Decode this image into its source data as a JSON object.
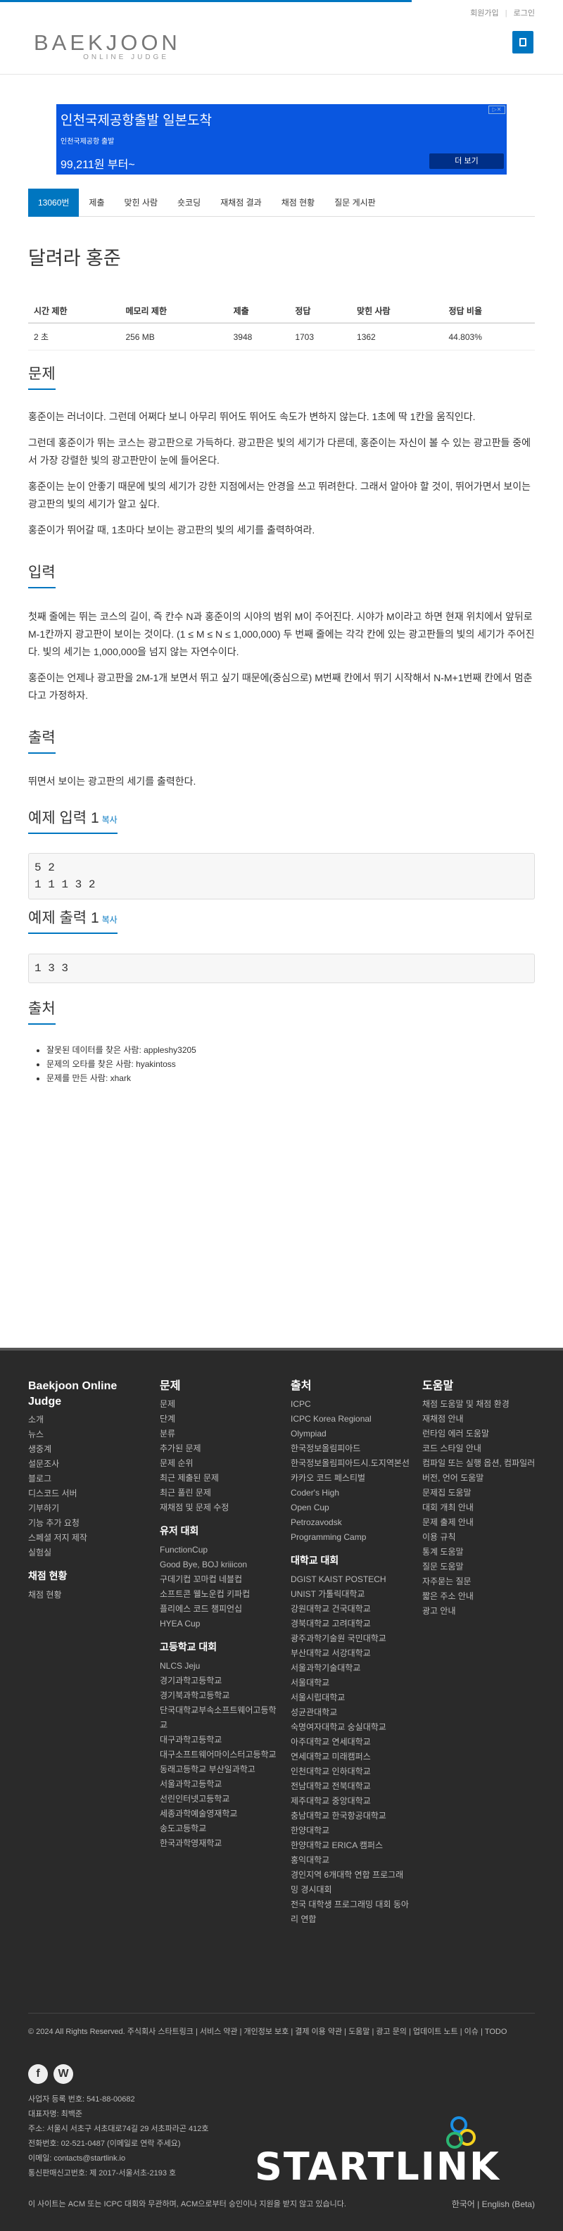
{
  "toplinks": {
    "signup": "회원가입",
    "login": "로그인"
  },
  "logo": {
    "big": "BAEKJOON",
    "small": "ONLINE JUDGE"
  },
  "ad": {
    "headline": "인천국제공항출발 일본도착",
    "sub": "인천국제공항 출발",
    "price": "99,211원 부터~",
    "button": "더 보기"
  },
  "tabs": [
    "13060번",
    "제출",
    "맞힌 사람",
    "숏코딩",
    "재채점 결과",
    "채점 현황",
    "질문 게시판"
  ],
  "problem": {
    "title": "달려라 홍준",
    "info_headers": [
      "시간 제한",
      "메모리 제한",
      "제출",
      "정답",
      "맞힌 사람",
      "정답 비율"
    ],
    "info_values": [
      "2 초",
      "256 MB",
      "3948",
      "1703",
      "1362",
      "44.803%"
    ],
    "section_problem": "문제",
    "problem_paras": [
      "홍준이는 러너이다. 그런데 어쩌다 보니 아무리 뛰어도 뛰어도 속도가 변하지 않는다. 1초에 딱 1칸을 움직인다.",
      "그런데 홍준이가 뛰는 코스는 광고판으로 가득하다. 광고판은 빛의 세기가 다른데, 홍준이는 자신이 볼 수 있는 광고판들 중에서 가장 강렬한 빛의 광고판만이 눈에 들어온다.",
      "홍준이는 눈이 안좋기 때문에 빛의 세기가 강한 지점에서는 안경을 쓰고 뛰려한다. 그래서 알아야 할 것이, 뛰어가면서 보이는 광고판의 빛의 세기가 알고 싶다.",
      "홍준이가 뛰어갈 때, 1초마다 보이는 광고판의 빛의 세기를 출력하여라."
    ],
    "section_input": "입력",
    "input_paras": [
      "첫째 줄에는 뛰는 코스의 길이, 즉 칸수 N과 홍준이의 시야의 범위 M이 주어진다. 시야가 M이라고 하면 현재 위치에서 앞뒤로 M-1칸까지 광고판이 보이는 것이다. (1 ≤ M ≤ N ≤ 1,000,000) 두 번째 줄에는 각각 칸에 있는 광고판들의 빛의 세기가 주어진다. 빛의 세기는 1,000,000을 넘지 않는 자연수이다.",
      "홍준이는 언제나 광고판을 2M-1개 보면서 뛰고 싶기 때문에(중심으로) M번째 칸에서 뛰기 시작해서 N-M+1번째 칸에서 멈춘다고 가정하자."
    ],
    "section_output": "출력",
    "output_paras": [
      "뛰면서 보이는 광고판의 세기를 출력한다."
    ],
    "sample_input_title": "예제 입력 1",
    "sample_output_title": "예제 출력 1",
    "copy_label": "복사",
    "sample_input": "5 2\n1 1 1 3 2",
    "sample_output": "1 3 3",
    "section_source": "출처",
    "source_items": [
      "잘못된 데이터를 찾은 사람: appleshy3205",
      "문제의 오타를 찾은 사람: hyakintoss",
      "문제를 만든 사람: xhark"
    ]
  },
  "footer": {
    "col1_title": "Baekjoon Online Judge",
    "col1_items": [
      "소개",
      "뉴스",
      "생중계",
      "설문조사",
      "블로그",
      "디스코드 서버",
      "기부하기",
      "기능 추가 요청",
      "스페셜 저지 제작",
      "실험실"
    ],
    "col1_sub_title": "채점 현황",
    "col1_sub_items": [
      "채점 현황"
    ],
    "col2_title": "문제",
    "col2_items": [
      "문제",
      "단계",
      "분류",
      "추가된 문제",
      "문제 순위",
      "최근 제출된 문제",
      "최근 풀린 문제",
      "재채점 및 문제 수정"
    ],
    "col2_sub1_title": "유저 대회",
    "col2_sub1_items": [
      "FunctionCup",
      "Good Bye, BOJ kriiicon",
      "구데기컵 꼬마컵 네블컵",
      "소프트콘 웰노운컵 키파컵",
      "플리에스 코드 챔피언십",
      "HYEA Cup"
    ],
    "col2_sub2_title": "고등학교 대회",
    "col2_sub2_items": [
      "NLCS Jeju",
      "경기과학고등학교",
      "경기북과학고등학교",
      "단국대학교부속소프트웨어고등학교",
      "대구과학고등학교",
      "대구소프트웨어마이스터고등학교",
      "동래고등학교 부산일과학고",
      "서울과학고등학교",
      "선린인터넷고등학교",
      "세종과학예술영재학교",
      "송도고등학교",
      "한국과학영재학교"
    ],
    "col3_title": "출처",
    "col3_items": [
      "ICPC",
      "ICPC Korea Regional",
      "Olympiad",
      "한국정보올림피아드",
      "한국정보올림피아드시.도지역본선",
      "카카오 코드 페스티벌",
      "Coder's High",
      "Open Cup",
      "Petrozavodsk",
      "Programming Camp"
    ],
    "col3_sub_title": "대학교 대회",
    "col3_sub_items": [
      "DGIST KAIST POSTECH UNIST 가톨릭대학교",
      "강원대학교 건국대학교",
      "경북대학교 고려대학교",
      "광주과학기술원 국민대학교",
      "부산대학교 서강대학교",
      "서울과학기술대학교",
      "서울대학교",
      "서울시립대학교",
      "성균관대학교",
      "숙명여자대학교 숭실대학교",
      "아주대학교 연세대학교",
      "연세대학교 미래캠퍼스",
      "인천대학교 인하대학교",
      "전남대학교 전북대학교",
      "제주대학교 중앙대학교",
      "충남대학교 한국항공대학교",
      "한양대학교",
      "한양대학교 ERICA 캠퍼스",
      "홍익대학교",
      "경인지역 6개대학 연합 프로그래밍 경시대회",
      "전국 대학생 프로그래밍 대회 동아리 연합"
    ],
    "col4_title": "도움말",
    "col4_items": [
      "채점 도움말 및 채점 환경",
      "재채점 안내",
      "런타임 에러 도움말",
      "코드 스타일 안내",
      "컴파일 또는 실행 옵션, 컴파일러 버전, 언어 도움말",
      "문제집 도움말",
      "대회 개최 안내",
      "문제 출제 안내",
      "이용 규칙",
      "통계 도움말",
      "질문 도움말",
      "자주묻는 질문",
      "짧은 주소 안내",
      "광고 안내"
    ],
    "legal": "© 2024 All Rights Reserved. 주식회사 스타트링크 | 서비스 약관 | 개인정보 보호 | 결제 이용 약관 | 도움말 | 광고 문의 | 업데이트 노트 | 이슈 | TODO",
    "company_lines": [
      "사업자 등록 번호: 541-88-00682",
      "대표자명: 최백준",
      "주소: 서울시 서초구 서초대로74길 29 서초파라곤 412호",
      "전화번호: 02-521-0487 (이메일로 연락 주세요)",
      "이메일: contacts@startlink.io",
      "통신판매신고번호: 제 2017-서울서초-2193 호"
    ],
    "brand": "STARTLINK",
    "note": "이 사이트는 ACM 또는 ICPC 대회와 무관하며, ACM으로부터 승인이나 지원을 받지 않고 있습니다.",
    "lang": "한국어 | English (Beta)"
  },
  "colors": {
    "accent": "#0076c0",
    "footer_bg": "#2a2a2a"
  }
}
